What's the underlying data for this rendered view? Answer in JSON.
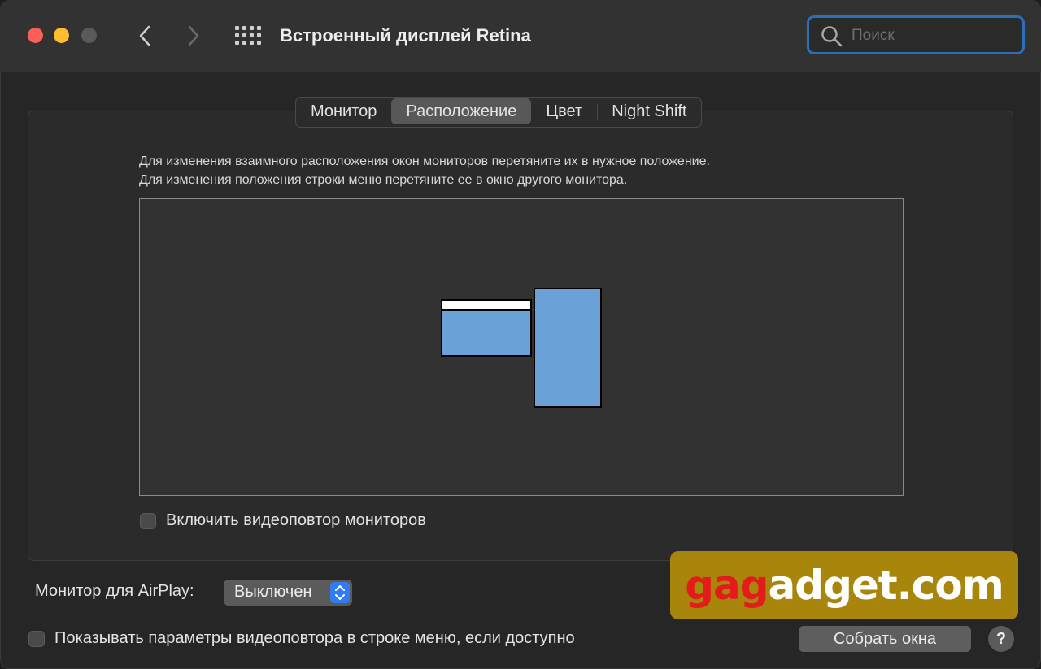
{
  "window": {
    "title": "Встроенный дисплей Retina"
  },
  "search": {
    "placeholder": "Поиск"
  },
  "tabs": [
    {
      "label": "Монитор",
      "selected": false
    },
    {
      "label": "Расположение",
      "selected": true
    },
    {
      "label": "Цвет",
      "selected": false
    },
    {
      "label": "Night Shift",
      "selected": false
    }
  ],
  "arrangement": {
    "instruction_1": "Для изменения взаимного расположения окон мониторов перетяните их в нужное положение.",
    "instruction_2": "Для изменения положения строки меню перетяните ее в окно другого монитора.",
    "display_color": "#6aa1d6"
  },
  "mirror": {
    "label": "Включить видеоповтор мониторов",
    "checked": false
  },
  "airplay": {
    "label": "Монитор для AirPlay:",
    "value": "Выключен"
  },
  "show_mirroring": {
    "label": "Показывать параметры видеоповтора в строке меню, если доступно",
    "checked": false
  },
  "buttons": {
    "gather": "Собрать окна",
    "help": "?"
  },
  "watermark": {
    "part1": "ga",
    "part2": "g",
    "part3": "adget.com"
  },
  "colors": {
    "accent": "#2f7cf6",
    "search_focus": "#2d6eb8",
    "close": "#fe5f57",
    "minimize": "#febc2e"
  }
}
